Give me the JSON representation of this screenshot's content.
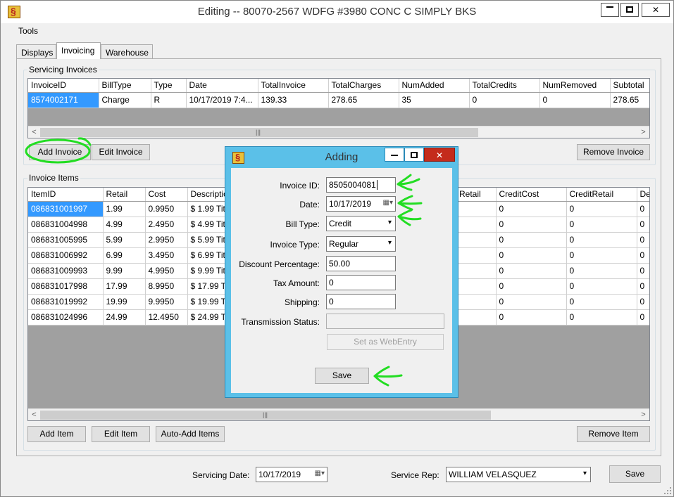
{
  "window": {
    "title": "Editing -- 80070-2567 WDFG #3980 CONC C SIMPLY BKS",
    "min_label": "▬",
    "max_label": "☐",
    "close_label": "✕"
  },
  "menu": {
    "tools": "Tools"
  },
  "tabs": [
    {
      "label": "Displays"
    },
    {
      "label": "Invoicing"
    },
    {
      "label": "Warehouse"
    }
  ],
  "servicing_invoices": {
    "group_label": "Servicing Invoices",
    "columns": [
      "InvoiceID",
      "BillType",
      "Type",
      "Date",
      "TotalInvoice",
      "TotalCharges",
      "NumAdded",
      "TotalCredits",
      "NumRemoved",
      "Subtotal"
    ],
    "rows": [
      [
        "8574002171",
        "Charge",
        "R",
        "10/17/2019 7:4...",
        "139.33",
        "278.65",
        "35",
        "0",
        "0",
        "278.65"
      ]
    ],
    "add_button": "Add Invoice",
    "edit_button": "Edit Invoice",
    "remove_button": "Remove Invoice"
  },
  "invoice_items": {
    "group_label": "Invoice Items",
    "columns_left": [
      "ItemID",
      "Retail",
      "Cost",
      "Descriptio"
    ],
    "columns_right": [
      "Retail",
      "CreditCost",
      "CreditRetail",
      "De"
    ],
    "rows_left": [
      [
        "086831001997",
        "1.99",
        "0.9950",
        "$  1.99 Tit"
      ],
      [
        "086831004998",
        "4.99",
        "2.4950",
        "$  4.99 Tit"
      ],
      [
        "086831005995",
        "5.99",
        "2.9950",
        "$  5.99 Tit"
      ],
      [
        "086831006992",
        "6.99",
        "3.4950",
        "$  6.99 Tit"
      ],
      [
        "086831009993",
        "9.99",
        "4.9950",
        "$  9.99 Tit"
      ],
      [
        "086831017998",
        "17.99",
        "8.9950",
        "$ 17.99 Tit"
      ],
      [
        "086831019992",
        "19.99",
        "9.9950",
        "$ 19.99 Tit"
      ],
      [
        "086831024996",
        "24.99",
        "12.4950",
        "$ 24.99 Tit"
      ]
    ],
    "rows_right": [
      [
        "",
        "0",
        "0",
        "0"
      ],
      [
        "",
        "0",
        "0",
        "0"
      ],
      [
        "",
        "0",
        "0",
        "0"
      ],
      [
        "",
        "0",
        "0",
        "0"
      ],
      [
        "",
        "0",
        "0",
        "0"
      ],
      [
        "",
        "0",
        "0",
        "0"
      ],
      [
        "",
        "0",
        "0",
        "0"
      ],
      [
        "",
        "0",
        "0",
        "0"
      ]
    ],
    "add_button": "Add Item",
    "edit_button": "Edit Item",
    "auto_add_button": "Auto-Add Items",
    "remove_button": "Remove Item"
  },
  "footer": {
    "servicing_date_label": "Servicing Date:",
    "servicing_date_value": "10/17/2019",
    "service_rep_label": "Service Rep:",
    "service_rep_value": "WILLIAM VELASQUEZ",
    "save_button": "Save"
  },
  "dialog": {
    "title": "Adding",
    "fields": {
      "invoice_id_label": "Invoice ID:",
      "invoice_id_value": "8505004081",
      "date_label": "Date:",
      "date_value": "10/17/2019",
      "bill_type_label": "Bill Type:",
      "bill_type_value": "Credit",
      "invoice_type_label": "Invoice Type:",
      "invoice_type_value": "Regular",
      "discount_label": "Discount Percentage:",
      "discount_value": "50.00",
      "tax_label": "Tax Amount:",
      "tax_value": "0",
      "shipping_label": "Shipping:",
      "shipping_value": "0",
      "transmission_label": "Transmission Status:",
      "transmission_value": ""
    },
    "webentry_button": "Set as WebEntry",
    "save_button": "Save"
  },
  "colors": {
    "dialog_frame": "#5bc0e8",
    "selection": "#3399ff",
    "annotation": "#22dd22",
    "close_red": "#c42b1c"
  },
  "icons": [
    "app-icon",
    "minimize-icon",
    "maximize-icon",
    "close-icon",
    "calendar-icon",
    "chevron-down-icon",
    "scroll-left-icon",
    "scroll-right-icon",
    "resize-grip-icon"
  ]
}
